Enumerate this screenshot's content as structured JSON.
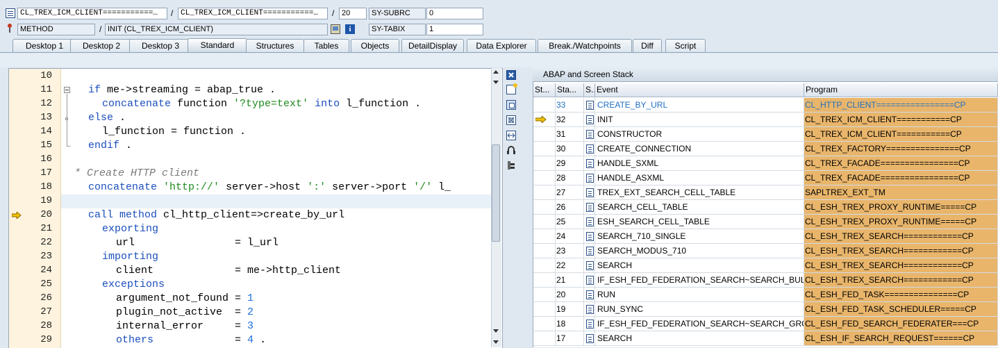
{
  "header": {
    "class_field1": "CL_TREX_ICM_CLIENT===========…",
    "class_field2": "CL_TREX_ICM_CLIENT===========…",
    "line_field": "20",
    "var1_name": "SY-SUBRC",
    "var1_value": "0",
    "type_field": "METHOD",
    "method_field": "INIT (CL_TREX_ICM_CLIENT)",
    "var2_name": "SY-TABIX",
    "var2_value": "1",
    "separator": "/"
  },
  "tabs": [
    "Desktop 1",
    "Desktop 2",
    "Desktop 3",
    "Standard",
    "Structures",
    "Tables",
    "Objects",
    "DetailDisplay",
    "Data Explorer",
    "Break./Watchpoints",
    "Diff",
    "Script"
  ],
  "active_tab": "Standard",
  "code": [
    {
      "n": "10",
      "parts": []
    },
    {
      "n": "11",
      "parts": [
        [
          "kw",
          "if"
        ],
        [
          "t",
          " me->streaming = abap_true ."
        ]
      ],
      "indent": 1
    },
    {
      "n": "12",
      "parts": [
        [
          "kw",
          "concatenate"
        ],
        [
          "t",
          " function "
        ],
        [
          "str",
          "'?type=text'"
        ],
        [
          "t",
          " "
        ],
        [
          "kw",
          "into"
        ],
        [
          "t",
          " l_function ."
        ]
      ],
      "indent": 2
    },
    {
      "n": "13",
      "parts": [
        [
          "kw",
          "else"
        ],
        [
          "t",
          " ."
        ]
      ],
      "indent": 1
    },
    {
      "n": "14",
      "parts": [
        [
          "t",
          "l_function = function ."
        ]
      ],
      "indent": 2
    },
    {
      "n": "15",
      "parts": [
        [
          "kw",
          "endif"
        ],
        [
          "t",
          " ."
        ]
      ],
      "indent": 1
    },
    {
      "n": "16",
      "parts": []
    },
    {
      "n": "17",
      "parts": [
        [
          "cmt",
          "* Create HTTP client"
        ]
      ],
      "indent": 0
    },
    {
      "n": "18",
      "parts": [
        [
          "kw",
          "concatenate"
        ],
        [
          "t",
          " "
        ],
        [
          "str",
          "'http://'"
        ],
        [
          "t",
          " server->host "
        ],
        [
          "str",
          "':'"
        ],
        [
          "t",
          " server->port "
        ],
        [
          "str",
          "'/'"
        ],
        [
          "t",
          " l_"
        ]
      ],
      "indent": 1
    },
    {
      "n": "19",
      "parts": []
    },
    {
      "n": "20",
      "parts": [
        [
          "kw",
          "call method"
        ],
        [
          "t",
          " cl_http_client=>create_by_url"
        ]
      ],
      "indent": 1
    },
    {
      "n": "21",
      "parts": [
        [
          "kw",
          "exporting"
        ]
      ],
      "indent": 2
    },
    {
      "n": "22",
      "parts": [
        [
          "t",
          "url                = l_url"
        ]
      ],
      "indent": 3
    },
    {
      "n": "23",
      "parts": [
        [
          "kw",
          "importing"
        ]
      ],
      "indent": 2
    },
    {
      "n": "24",
      "parts": [
        [
          "t",
          "client             = me->http_client"
        ]
      ],
      "indent": 3
    },
    {
      "n": "25",
      "parts": [
        [
          "kw",
          "exceptions"
        ]
      ],
      "indent": 2
    },
    {
      "n": "26",
      "parts": [
        [
          "t",
          "argument_not_found = "
        ],
        [
          "num",
          "1"
        ]
      ],
      "indent": 3
    },
    {
      "n": "27",
      "parts": [
        [
          "t",
          "plugin_not_active  = "
        ],
        [
          "num",
          "2"
        ]
      ],
      "indent": 3
    },
    {
      "n": "28",
      "parts": [
        [
          "t",
          "internal_error     = "
        ],
        [
          "num",
          "3"
        ]
      ],
      "indent": 3
    },
    {
      "n": "29",
      "parts": [
        [
          "kw",
          "others"
        ],
        [
          "t",
          "             = "
        ],
        [
          "num",
          "4"
        ],
        [
          "t",
          " ."
        ]
      ],
      "indent": 3
    }
  ],
  "stack": {
    "title": "ABAP and Screen Stack",
    "columns": [
      "St...",
      "Sta...",
      "S...",
      "Event",
      "Program"
    ],
    "rows": [
      {
        "level": "33",
        "event": "CREATE_BY_URL",
        "program": "CL_HTTP_CLIENT================CP"
      },
      {
        "level": "32",
        "event": "INIT",
        "program": "CL_TREX_ICM_CLIENT===========CP",
        "current": true
      },
      {
        "level": "31",
        "event": "CONSTRUCTOR",
        "program": "CL_TREX_ICM_CLIENT===========CP"
      },
      {
        "level": "30",
        "event": "CREATE_CONNECTION",
        "program": "CL_TREX_FACTORY===============CP"
      },
      {
        "level": "29",
        "event": "HANDLE_SXML",
        "program": "CL_TREX_FACADE================CP"
      },
      {
        "level": "28",
        "event": "HANDLE_ASXML",
        "program": "CL_TREX_FACADE================CP"
      },
      {
        "level": "27",
        "event": "TREX_EXT_SEARCH_CELL_TABLE",
        "program": "SAPLTREX_EXT_TM"
      },
      {
        "level": "26",
        "event": "SEARCH_CELL_TABLE",
        "program": "CL_ESH_TREX_PROXY_RUNTIME=====CP"
      },
      {
        "level": "25",
        "event": "ESH_SEARCH_CELL_TABLE",
        "program": "CL_ESH_TREX_PROXY_RUNTIME=====CP"
      },
      {
        "level": "24",
        "event": "SEARCH_710_SINGLE",
        "program": "CL_ESH_TREX_SEARCH============CP"
      },
      {
        "level": "23",
        "event": "SEARCH_MODUS_710",
        "program": "CL_ESH_TREX_SEARCH============CP"
      },
      {
        "level": "22",
        "event": "SEARCH",
        "program": "CL_ESH_TREX_SEARCH============CP"
      },
      {
        "level": "21",
        "event": "IF_ESH_FED_FEDERATION_SEARCH~SEARCH_BULK",
        "program": "CL_ESH_TREX_SEARCH============CP"
      },
      {
        "level": "20",
        "event": "RUN",
        "program": "CL_ESH_FED_TASK===============CP"
      },
      {
        "level": "19",
        "event": "RUN_SYNC",
        "program": "CL_ESH_FED_TASK_SCHEDULER=====CP"
      },
      {
        "level": "18",
        "event": "IF_ESH_FED_FEDERATION_SEARCH~SEARCH_GROU…",
        "program": "CL_ESH_FED_SEARCH_FEDERATER===CP"
      },
      {
        "level": "17",
        "event": "SEARCH",
        "program": "CL_ESH_IF_SEARCH_REQUEST======CP"
      }
    ]
  },
  "colors": {
    "accent": "#1b4ebd",
    "string": "#1f8a1f",
    "program_bg": "#e8b56b"
  }
}
